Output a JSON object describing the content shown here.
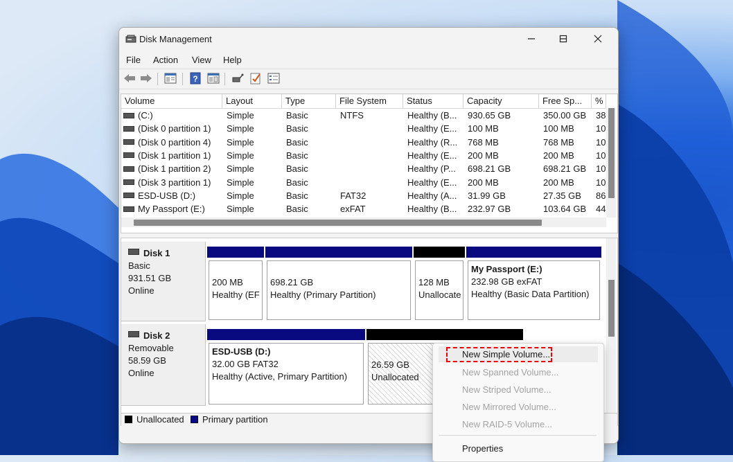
{
  "window": {
    "title": "Disk Management"
  },
  "menu": [
    "File",
    "Action",
    "View",
    "Help"
  ],
  "toolbar_icons": [
    "back-arrow-icon",
    "forward-arrow-icon",
    "disk-list-icon",
    "help-icon",
    "properties-icon",
    "connect-icon",
    "check-icon",
    "settings-list-icon"
  ],
  "volume_table": {
    "headers": [
      "Volume",
      "Layout",
      "Type",
      "File System",
      "Status",
      "Capacity",
      "Free Sp...",
      "%"
    ],
    "rows": [
      {
        "volume": "(C:)",
        "layout": "Simple",
        "type": "Basic",
        "fs": "NTFS",
        "status": "Healthy (B...",
        "capacity": "930.65 GB",
        "free": "350.00 GB",
        "pct": "38"
      },
      {
        "volume": "(Disk 0 partition 1)",
        "layout": "Simple",
        "type": "Basic",
        "fs": "",
        "status": "Healthy (E...",
        "capacity": "100 MB",
        "free": "100 MB",
        "pct": "10"
      },
      {
        "volume": "(Disk 0 partition 4)",
        "layout": "Simple",
        "type": "Basic",
        "fs": "",
        "status": "Healthy (R...",
        "capacity": "768 MB",
        "free": "768 MB",
        "pct": "10"
      },
      {
        "volume": "(Disk 1 partition 1)",
        "layout": "Simple",
        "type": "Basic",
        "fs": "",
        "status": "Healthy (E...",
        "capacity": "200 MB",
        "free": "200 MB",
        "pct": "10"
      },
      {
        "volume": "(Disk 1 partition 2)",
        "layout": "Simple",
        "type": "Basic",
        "fs": "",
        "status": "Healthy (P...",
        "capacity": "698.21 GB",
        "free": "698.21 GB",
        "pct": "10"
      },
      {
        "volume": "(Disk 3 partition 1)",
        "layout": "Simple",
        "type": "Basic",
        "fs": "",
        "status": "Healthy (E...",
        "capacity": "200 MB",
        "free": "200 MB",
        "pct": "10"
      },
      {
        "volume": "ESD-USB (D:)",
        "layout": "Simple",
        "type": "Basic",
        "fs": "FAT32",
        "status": "Healthy (A...",
        "capacity": "31.99 GB",
        "free": "27.35 GB",
        "pct": "86"
      },
      {
        "volume": "My Passport (E:)",
        "layout": "Simple",
        "type": "Basic",
        "fs": "exFAT",
        "status": "Healthy (B...",
        "capacity": "232.97 GB",
        "free": "103.64 GB",
        "pct": "44"
      }
    ]
  },
  "disks": [
    {
      "name": "Disk 1",
      "kind": "Basic",
      "size": "931.51 GB",
      "state": "Online",
      "partitions": [
        {
          "title": "",
          "line1": "200 MB",
          "line2": "Healthy (EF",
          "bar": "#0a0a80"
        },
        {
          "title": "",
          "line1": "698.21 GB",
          "line2": "Healthy (Primary Partition)",
          "bar": "#0a0a80"
        },
        {
          "title": "",
          "line1": "128 MB",
          "line2": "Unallocate",
          "bar": "#000000"
        },
        {
          "title": "My Passport  (E:)",
          "line1": "232.98 GB exFAT",
          "line2": "Healthy (Basic Data Partition)",
          "bar": "#0a0a80"
        }
      ]
    },
    {
      "name": "Disk 2",
      "kind": "Removable",
      "size": "58.59 GB",
      "state": "Online",
      "partitions": [
        {
          "title": "ESD-USB  (D:)",
          "line1": "32.00 GB FAT32",
          "line2": "Healthy (Active, Primary Partition)",
          "bar": "#0a0a80"
        },
        {
          "title": "",
          "line1": "26.59 GB",
          "line2": "Unallocated",
          "bar": "#000000"
        }
      ]
    }
  ],
  "legend": [
    {
      "label": "Unallocated",
      "color": "#000000"
    },
    {
      "label": "Primary partition",
      "color": "#0a0a80"
    }
  ],
  "context_menu": {
    "items": [
      {
        "label": "New Simple Volume...",
        "enabled": true
      },
      {
        "label": "New Spanned Volume...",
        "enabled": false
      },
      {
        "label": "New Striped Volume...",
        "enabled": false
      },
      {
        "label": "New Mirrored Volume...",
        "enabled": false
      },
      {
        "label": "New RAID-5 Volume...",
        "enabled": false
      },
      {
        "label": "Properties",
        "enabled": true
      }
    ]
  }
}
